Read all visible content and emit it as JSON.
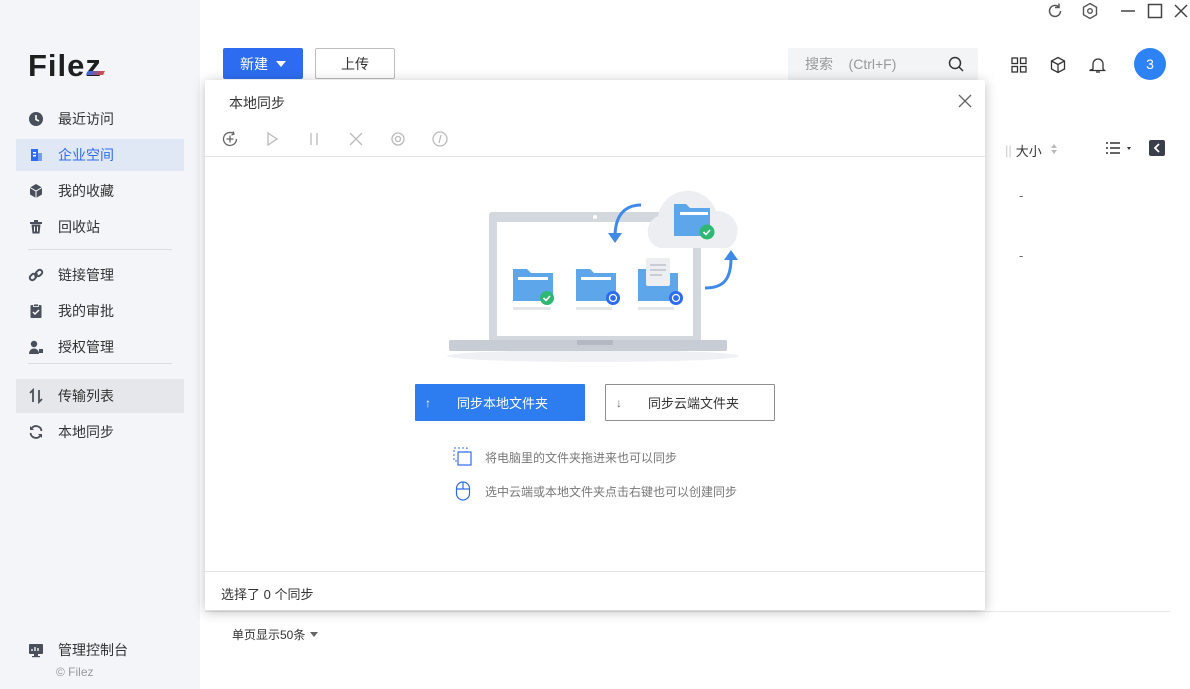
{
  "brand": {
    "logo_text": "File",
    "logo_z": "z",
    "copyright": "© Filez"
  },
  "sidebar": {
    "items": [
      {
        "label": "最近访问",
        "icon": "clock-icon"
      },
      {
        "label": "企业空间",
        "icon": "building-icon",
        "active": true
      },
      {
        "label": "我的收藏",
        "icon": "cube-icon"
      },
      {
        "label": "回收站",
        "icon": "trash-icon"
      },
      {
        "label": "链接管理",
        "icon": "link-icon"
      },
      {
        "label": "我的审批",
        "icon": "clipboard-check-icon"
      },
      {
        "label": "授权管理",
        "icon": "user-key-icon"
      },
      {
        "label": "传输列表",
        "icon": "transfer-icon"
      },
      {
        "label": "本地同步",
        "icon": "sync-icon"
      }
    ],
    "console": {
      "label": "管理控制台",
      "icon": "monitor-icon"
    }
  },
  "window_controls": {
    "refresh": "refresh-icon",
    "settings": "hex-gear-icon",
    "minimize": "minimize-icon",
    "maximize": "maximize-icon",
    "close": "close-icon"
  },
  "toolbar": {
    "new_label": "新建",
    "upload_label": "上传",
    "search_placeholder": "搜索    (Ctrl+F)",
    "avatar_text": "3"
  },
  "list": {
    "size_header": "大小",
    "rows": [
      "-",
      "-"
    ],
    "page_size_label": "单页显示50条"
  },
  "modal": {
    "title": "本地同步",
    "tools": [
      "add-sync-icon",
      "play-icon",
      "pause-icon",
      "stop-icon",
      "preview-icon",
      "info-icon"
    ],
    "sync_local_label": "同步本地文件夹",
    "sync_cloud_label": "同步云端文件夹",
    "hint_drag": "将电脑里的文件夹拖进来也可以同步",
    "hint_right_click": "选中云端或本地文件夹点击右键也可以创建同步",
    "footer": "选择了 0 个同步"
  },
  "colors": {
    "accent": "#2d6cf0",
    "sidebar_bg": "#f4f5f9",
    "active_bg": "#e1e8f5",
    "success": "#2eb872"
  }
}
